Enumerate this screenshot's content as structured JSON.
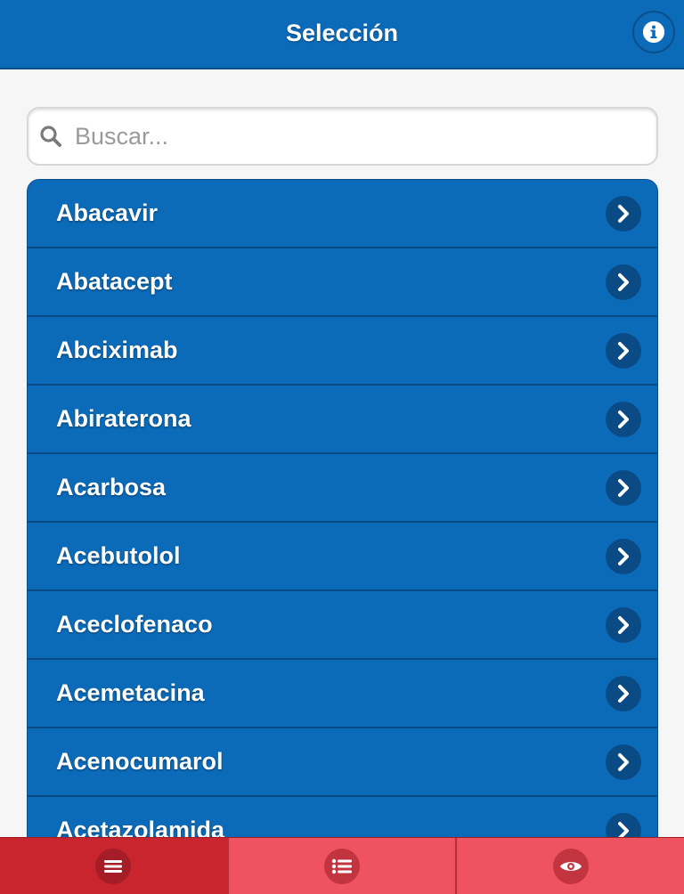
{
  "header": {
    "title": "Selección",
    "info_icon": "info-icon"
  },
  "search": {
    "placeholder": "Buscar...",
    "value": "",
    "icon": "search-icon"
  },
  "list": {
    "items": [
      {
        "label": "Abacavir"
      },
      {
        "label": "Abatacept"
      },
      {
        "label": "Abciximab"
      },
      {
        "label": "Abiraterona"
      },
      {
        "label": "Acarbosa"
      },
      {
        "label": "Acebutolol"
      },
      {
        "label": "Aceclofenaco"
      },
      {
        "label": "Acemetacina"
      },
      {
        "label": "Acenocumarol"
      },
      {
        "label": "Acetazolamida"
      }
    ],
    "item_icon": "chevron-right-icon"
  },
  "tabbar": {
    "tabs": [
      {
        "icon": "menu-icon",
        "active": true
      },
      {
        "icon": "list-icon",
        "active": false
      },
      {
        "icon": "eye-icon",
        "active": false
      }
    ]
  },
  "colors": {
    "header_bg": "#0b6bb9",
    "list_bg": "#0b6bb9",
    "tab_active": "#c8252f",
    "tab_inactive": "#ef535f"
  }
}
